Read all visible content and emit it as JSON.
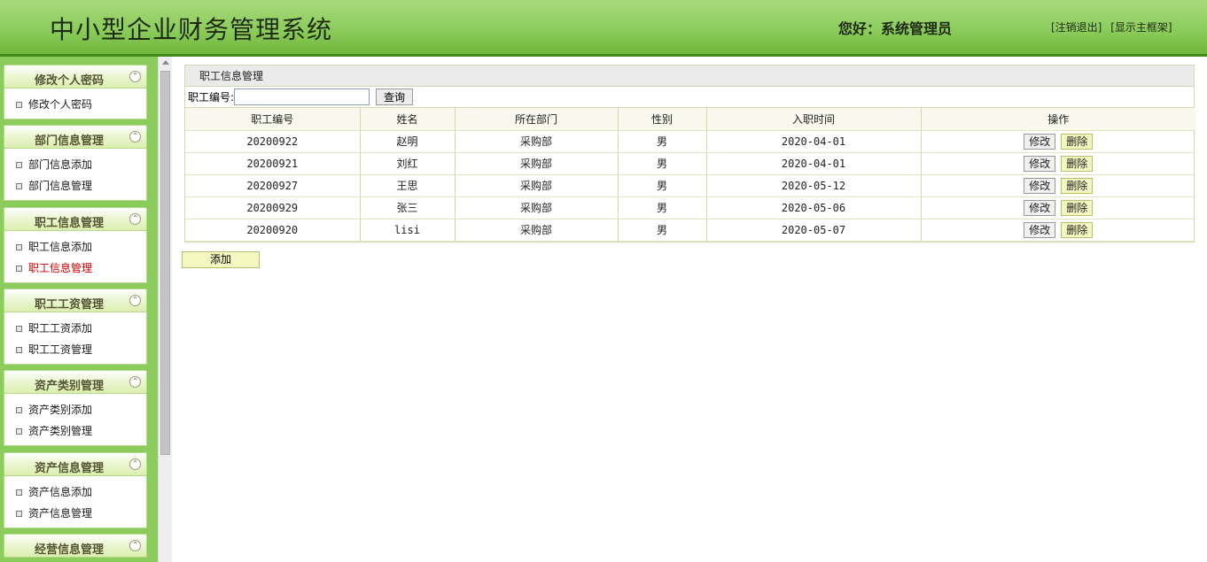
{
  "header": {
    "title": "中小型企业财务管理系统",
    "greeting": "您好：系统管理员",
    "logout_link": "[注销退出]",
    "show_frame_link": "[显示主框架]"
  },
  "sidebar": {
    "sections": [
      {
        "title": "修改个人密码",
        "items": [
          {
            "label": "修改个人密码"
          }
        ]
      },
      {
        "title": "部门信息管理",
        "items": [
          {
            "label": "部门信息添加"
          },
          {
            "label": "部门信息管理"
          }
        ]
      },
      {
        "title": "职工信息管理",
        "items": [
          {
            "label": "职工信息添加"
          },
          {
            "label": "职工信息管理"
          }
        ]
      },
      {
        "title": "职工工资管理",
        "items": [
          {
            "label": "职工工资添加"
          },
          {
            "label": "职工工资管理"
          }
        ]
      },
      {
        "title": "资产类别管理",
        "items": [
          {
            "label": "资产类别添加"
          },
          {
            "label": "资产类别管理"
          }
        ]
      },
      {
        "title": "资产信息管理",
        "items": [
          {
            "label": "资产信息添加"
          },
          {
            "label": "资产信息管理"
          }
        ]
      },
      {
        "title": "经营信息管理",
        "items": []
      }
    ],
    "active_item": "职工信息管理",
    "collapse_icon": "chevron-up-icon"
  },
  "main": {
    "panel_title": "职工信息管理",
    "search": {
      "label": "职工编号:",
      "value": "",
      "button": "查询"
    },
    "columns": [
      "职工编号",
      "姓名",
      "所在部门",
      "性别",
      "入职时间",
      "操作"
    ],
    "rows": [
      {
        "id": "20200922",
        "name": "赵明",
        "dept": "采购部",
        "gender": "男",
        "date": "2020-04-01"
      },
      {
        "id": "20200921",
        "name": "刘红",
        "dept": "采购部",
        "gender": "男",
        "date": "2020-04-01"
      },
      {
        "id": "20200927",
        "name": "王思",
        "dept": "采购部",
        "gender": "男",
        "date": "2020-05-12"
      },
      {
        "id": "20200929",
        "name": "张三",
        "dept": "采购部",
        "gender": "男",
        "date": "2020-05-06"
      },
      {
        "id": "20200920",
        "name": "lisi",
        "dept": "采购部",
        "gender": "男",
        "date": "2020-05-07"
      }
    ],
    "edit_label": "修改",
    "delete_label": "删除",
    "add_button": "添加"
  },
  "colors": {
    "header_green": "#8ccc5c",
    "header_border": "#3f8a1a",
    "active_menu": "#cc0000",
    "delete_button_bg": "#f4f8c0"
  }
}
